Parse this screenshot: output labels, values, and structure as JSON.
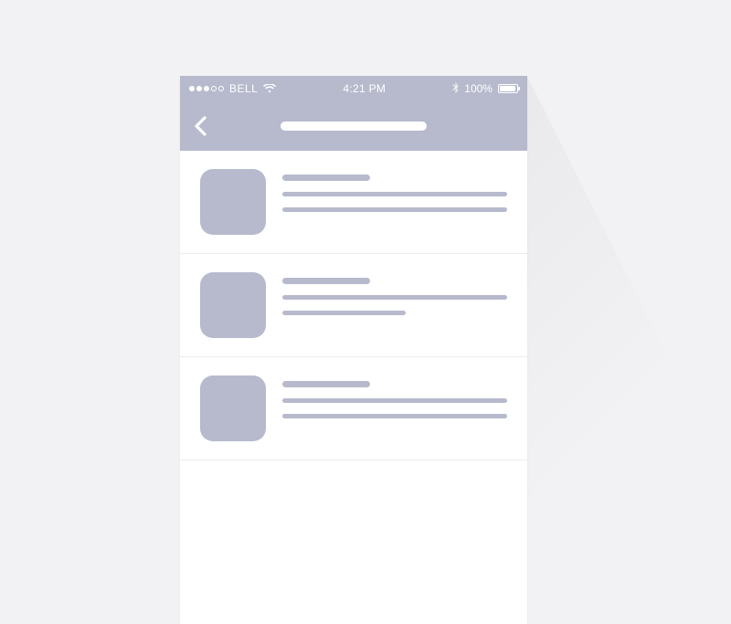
{
  "status_bar": {
    "carrier": "BELL",
    "time": "4:21 PM",
    "battery_text": "100%"
  },
  "colors": {
    "accent": "#b7bacd",
    "bg": "#f2f2f4"
  },
  "list": {
    "rows": [
      {
        "title": "",
        "line1": "",
        "line2": ""
      },
      {
        "title": "",
        "line1": "",
        "line2": ""
      },
      {
        "title": "",
        "line1": "",
        "line2": ""
      }
    ]
  }
}
